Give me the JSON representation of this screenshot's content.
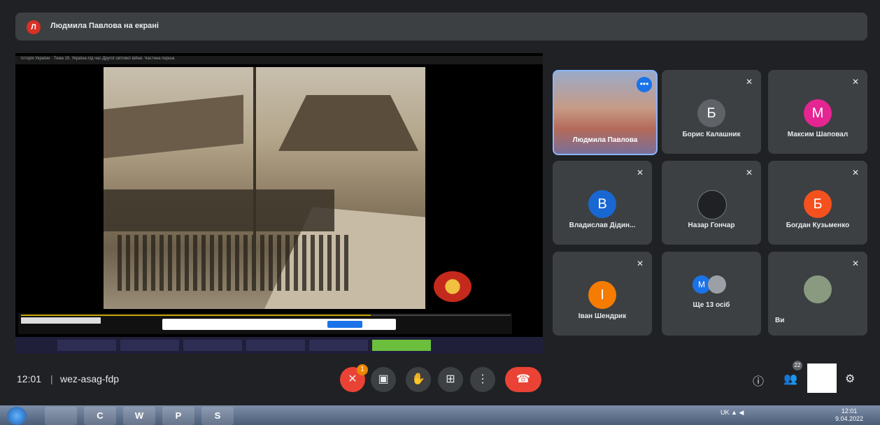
{
  "banner": {
    "avatar_letter": "Л",
    "text": "Людмила Павлова на екрані"
  },
  "shared_screen": {
    "window_title": "Історія України  ·  Тема 15. Україна під час Другої світової війни. Частина перша",
    "dialog_button": "Кнопка доступу"
  },
  "participants": {
    "self": {
      "name": "Людмила Павлова"
    },
    "tiles": [
      {
        "name": "Борис Калашник",
        "initial": "Б",
        "color": "#5f6368"
      },
      {
        "name": "Максим Шаповал",
        "initial": "М",
        "color": "#e52592"
      },
      {
        "name": "Владислав Дідин...",
        "initial": "В",
        "color": "#1967d2"
      },
      {
        "name": "Назар Гончар",
        "initial": "",
        "color": "#202124"
      },
      {
        "name": "Богдан Кузьменко",
        "initial": "Б",
        "color": "#f4511e"
      },
      {
        "name": "Іван Шендрик",
        "initial": "І",
        "color": "#f57c00"
      },
      {
        "name": "Ще 13 осіб",
        "initial": "М",
        "color": "#1a73e8"
      },
      {
        "name": "Ви",
        "initial": "",
        "color": "#5f6368"
      }
    ]
  },
  "controls": {
    "clock": "12:01",
    "separator": "|",
    "meeting_code": "wez-asag-fdp",
    "badge_count": "1",
    "people_count": "22"
  },
  "win_taskbar": {
    "apps": [
      "",
      "C",
      "W",
      "P",
      "S"
    ],
    "tray_text": "UK  ▲  ◀",
    "time": "12:01",
    "date": "9.04.2022"
  },
  "icons": [
    "mic-off-icon",
    "camera-icon",
    "hand-icon",
    "present-icon",
    "more-vert-icon",
    "call-end-icon",
    "info-icon",
    "people-icon",
    "activities-icon"
  ]
}
